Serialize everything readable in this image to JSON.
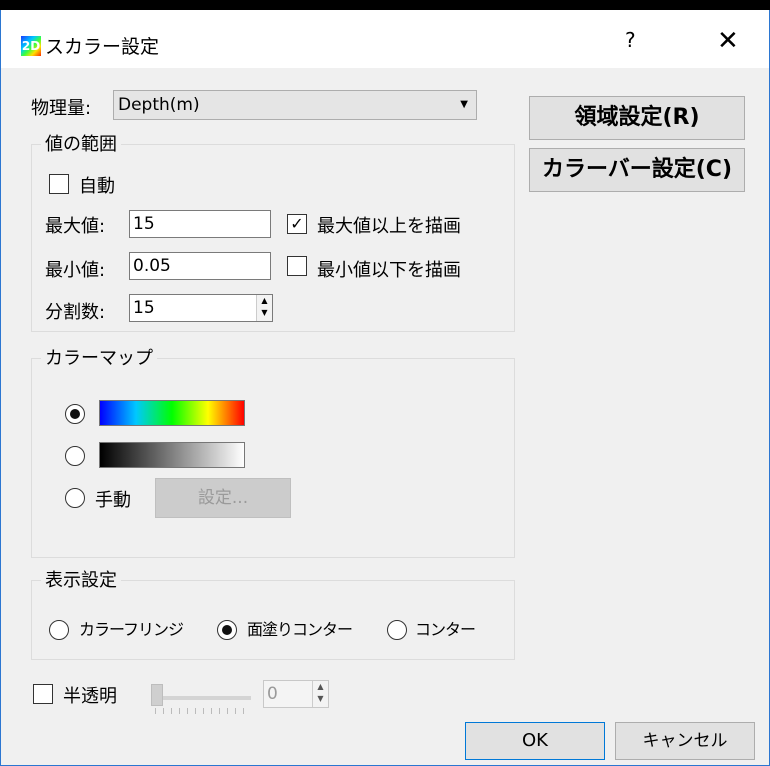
{
  "dialog": {
    "title": "スカラー設定",
    "icon_text": "2D",
    "help": "?",
    "close": "✕"
  },
  "physical_quantity": {
    "label": "物理量:",
    "selected": "Depth(m)"
  },
  "buttons": {
    "region": "領域設定(R)",
    "colorbar": "カラーバー設定(C)",
    "ok": "OK",
    "cancel": "キャンセル"
  },
  "value_range": {
    "title": "値の範囲",
    "auto_label": "自動",
    "max_label": "最大値:",
    "max_value": "15",
    "min_label": "最小値:",
    "min_value": "0.05",
    "divisions_label": "分割数:",
    "divisions_value": "15",
    "draw_above_max": "最大値以上を描画",
    "draw_below_min": "最小値以下を描画"
  },
  "colormap": {
    "title": "カラーマップ",
    "manual_label": "手動",
    "setting_button": "設定..."
  },
  "display": {
    "title": "表示設定",
    "options": [
      "カラーフリンジ",
      "面塗りコンター",
      "コンター"
    ]
  },
  "transparency": {
    "label": "半透明",
    "value": "0"
  }
}
